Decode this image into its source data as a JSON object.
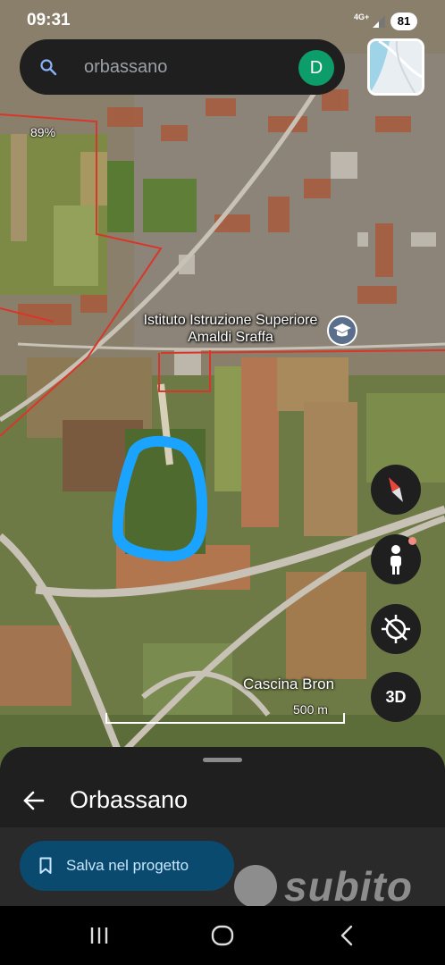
{
  "status_bar": {
    "time": "09:31",
    "network": "4G+",
    "battery": "81"
  },
  "search": {
    "placeholder": "orbassano",
    "avatar_initial": "D"
  },
  "map": {
    "tilt_indicator": "89%",
    "poi_label": "Istituto Istruzione Superiore Amaldi Sraffa",
    "place_label": "Cascina Bron",
    "scale_label": "500 m",
    "colors": {
      "boundary": "#d9362b",
      "annotation": "#1aa3ff"
    }
  },
  "controls": {
    "compass_icon": "compass-icon",
    "pegman_icon": "pegman-icon",
    "location_icon": "location-disabled-icon",
    "three_d_label": "3D"
  },
  "sheet": {
    "title": "Orbassano",
    "save_button": "Salva nel progetto"
  },
  "watermark": {
    "text": "subito"
  },
  "nav": {
    "recents_icon": "recents-icon",
    "home_icon": "home-icon",
    "back_icon": "back-icon"
  }
}
